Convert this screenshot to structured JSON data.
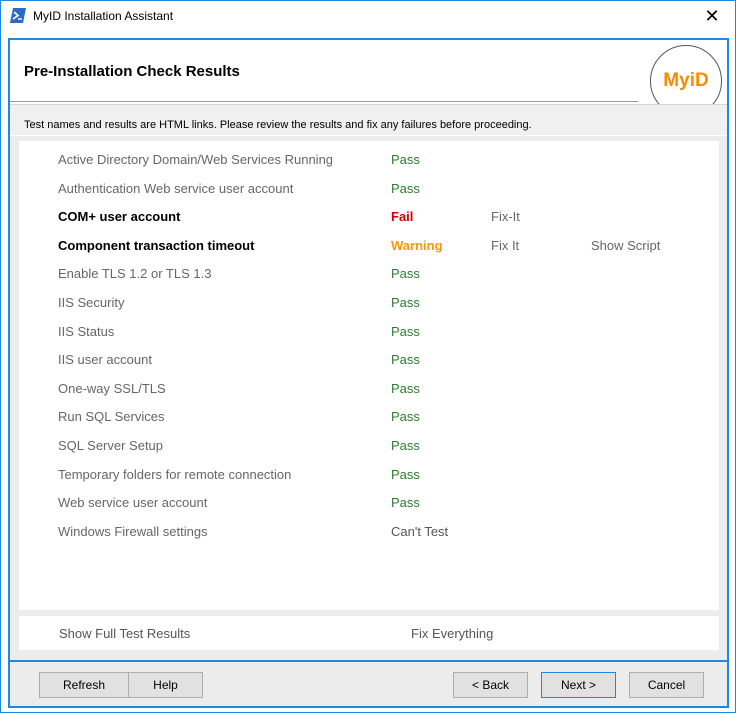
{
  "window": {
    "title": "MyID Installation Assistant",
    "icon": "powershell-icon",
    "close_glyph": "✕"
  },
  "header": {
    "title": "Pre-Installation Check Results",
    "logo_my": "My",
    "logo_id": "iD"
  },
  "info": {
    "text": "Test names and results are HTML links. Please review the results and fix any failures before proceeding."
  },
  "results": [
    {
      "name": "Active Directory Domain/Web Services Running",
      "status": "Pass",
      "kind": "pass",
      "bold": false,
      "fix": "",
      "script": ""
    },
    {
      "name": "Authentication Web service user account",
      "status": "Pass",
      "kind": "pass",
      "bold": false,
      "fix": "",
      "script": ""
    },
    {
      "name": "COM+ user account",
      "status": "Fail",
      "kind": "fail",
      "bold": true,
      "fix": "Fix-It",
      "script": ""
    },
    {
      "name": "Component transaction timeout",
      "status": "Warning",
      "kind": "warn",
      "bold": true,
      "fix": "Fix It",
      "script": "Show Script"
    },
    {
      "name": "Enable TLS 1.2 or TLS 1.3",
      "status": "Pass",
      "kind": "pass",
      "bold": false,
      "fix": "",
      "script": ""
    },
    {
      "name": "IIS Security",
      "status": "Pass",
      "kind": "pass",
      "bold": false,
      "fix": "",
      "script": ""
    },
    {
      "name": "IIS Status",
      "status": "Pass",
      "kind": "pass",
      "bold": false,
      "fix": "",
      "script": ""
    },
    {
      "name": "IIS user account",
      "status": "Pass",
      "kind": "pass",
      "bold": false,
      "fix": "",
      "script": ""
    },
    {
      "name": "One-way SSL/TLS",
      "status": "Pass",
      "kind": "pass",
      "bold": false,
      "fix": "",
      "script": ""
    },
    {
      "name": "Run SQL Services",
      "status": "Pass",
      "kind": "pass",
      "bold": false,
      "fix": "",
      "script": ""
    },
    {
      "name": "SQL Server Setup",
      "status": "Pass",
      "kind": "pass",
      "bold": false,
      "fix": "",
      "script": ""
    },
    {
      "name": "Temporary folders for remote connection",
      "status": "Pass",
      "kind": "pass",
      "bold": false,
      "fix": "",
      "script": ""
    },
    {
      "name": "Web service user account",
      "status": "Pass",
      "kind": "pass",
      "bold": false,
      "fix": "",
      "script": ""
    },
    {
      "name": "Windows Firewall settings",
      "status": "Can't Test",
      "kind": "cant",
      "bold": false,
      "fix": "",
      "script": ""
    }
  ],
  "footer_links": {
    "show_full": "Show Full Test Results",
    "fix_everything": "Fix Everything"
  },
  "buttons": {
    "refresh": "Refresh",
    "help": "Help",
    "back": "< Back",
    "next": "Next >",
    "cancel": "Cancel"
  },
  "colors": {
    "accent": "#1e88e5",
    "pass": "#2e7d32",
    "fail": "#d50000",
    "warning": "#ff9800"
  }
}
